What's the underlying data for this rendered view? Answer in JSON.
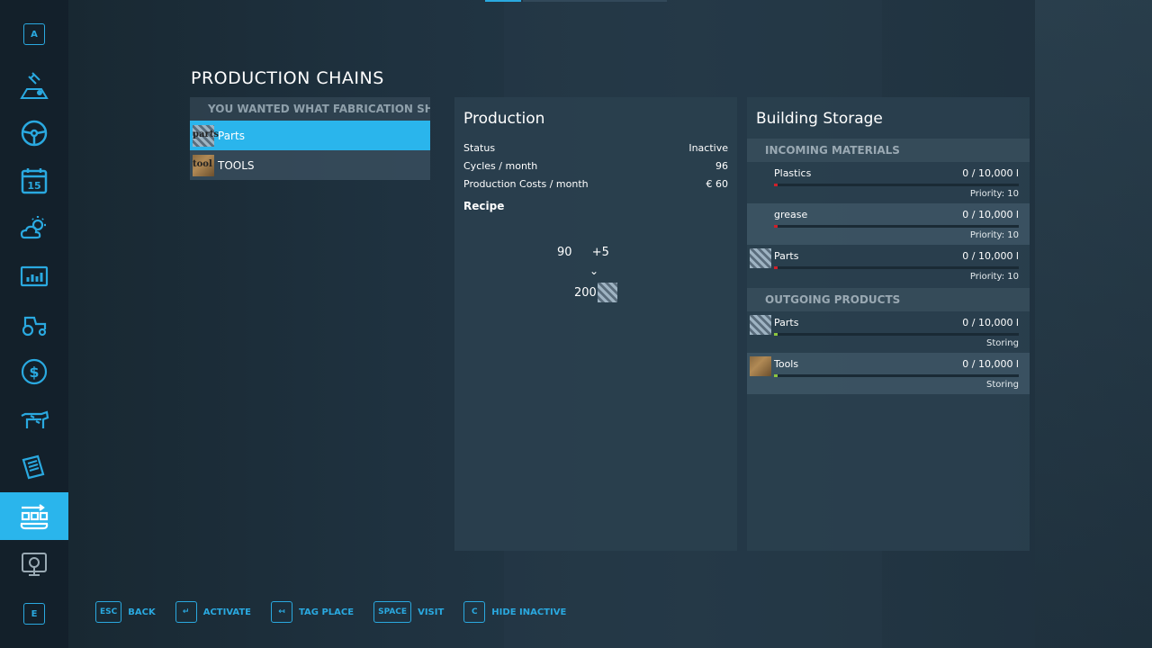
{
  "sidebar": {
    "top_key": "A",
    "bottom_key": "E",
    "items": [
      {
        "icon": "satellite-map-icon"
      },
      {
        "icon": "steering-wheel-icon"
      },
      {
        "icon": "calendar-icon",
        "label": "15"
      },
      {
        "icon": "weather-icon"
      },
      {
        "icon": "statistics-icon"
      },
      {
        "icon": "tractor-icon"
      },
      {
        "icon": "dollar-icon"
      },
      {
        "icon": "cow-icon"
      },
      {
        "icon": "contracts-icon"
      },
      {
        "icon": "production-icon",
        "active": true
      },
      {
        "icon": "help-icon"
      }
    ]
  },
  "page_title": "PRODUCTION CHAINS",
  "chains": {
    "header": "YOU WANTED WHAT FABRICATION SHO...",
    "items": [
      {
        "label": "Parts",
        "thumb": "parts",
        "thumb_text": "parts"
      },
      {
        "label": "TOOLS",
        "thumb": "tools",
        "thumb_text": "tool"
      }
    ]
  },
  "production": {
    "title": "Production",
    "stats": [
      {
        "label": "Status",
        "value": "Inactive"
      },
      {
        "label": "Cycles / month",
        "value": "96"
      },
      {
        "label": "Production Costs / month",
        "value": "€ 60"
      }
    ],
    "recipe_label": "Recipe",
    "recipe": {
      "input_amount": "90",
      "input_extra": "+5",
      "arrow": "⌄",
      "output_amount": "200"
    }
  },
  "storage": {
    "title": "Building Storage",
    "incoming_header": "INCOMING MATERIALS",
    "incoming": [
      {
        "name": "Plastics",
        "amount": "0  / 10,000 l",
        "status": "Priority: 10",
        "thumb": "",
        "fill_color": "#d0202a",
        "fill_level": 0
      },
      {
        "name": "grease",
        "amount": "0  / 10,000 l",
        "status": "Priority: 10",
        "thumb": "",
        "fill_color": "#d0202a",
        "fill_level": 0
      },
      {
        "name": "Parts",
        "amount": "0  / 10,000 l",
        "status": "Priority: 10",
        "thumb": "parts",
        "fill_color": "#d0202a",
        "fill_level": 0
      }
    ],
    "outgoing_header": "OUTGOING PRODUCTS",
    "outgoing": [
      {
        "name": "Parts",
        "amount": "0  / 10,000 l",
        "status": "Storing",
        "thumb": "parts",
        "fill_color": "#8cc63e",
        "fill_level": 0
      },
      {
        "name": "Tools",
        "amount": "0  / 10,000 l",
        "status": "Storing",
        "thumb": "tools",
        "fill_color": "#8cc63e",
        "fill_level": 0
      }
    ]
  },
  "bottom_bar": [
    {
      "key": "ESC",
      "label": "BACK"
    },
    {
      "key": "↵",
      "label": "ACTIVATE"
    },
    {
      "key": "↤",
      "label": "TAG PLACE"
    },
    {
      "key": "SPACE",
      "label": "VISIT"
    },
    {
      "key": "C",
      "label": "HIDE INACTIVE"
    }
  ],
  "colors": {
    "accent": "#2ab5ec",
    "incoming_marker": "#d0202a",
    "outgoing_marker": "#8cc63e"
  }
}
